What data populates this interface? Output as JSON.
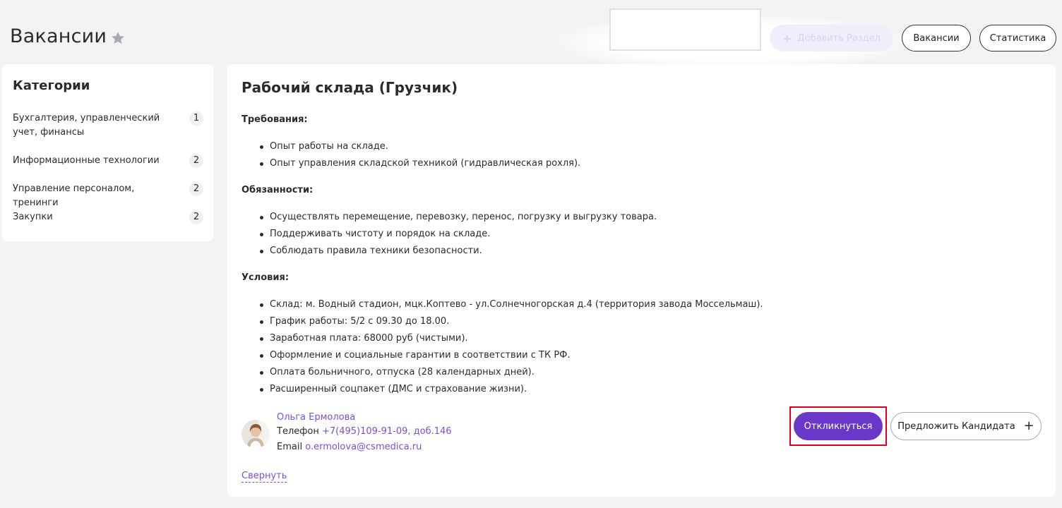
{
  "header": {
    "title": "Вакансии",
    "favorite_icon": "star-icon",
    "add_section_label": "Добавить Раздел",
    "nav": {
      "vacancies_label": "Вакансии",
      "statistics_label": "Статистика"
    }
  },
  "sidebar": {
    "title": "Категории",
    "items": [
      {
        "label": "Бухгалтерия, управленческий учет, финансы",
        "count": "1"
      },
      {
        "label": "Информационные технологии",
        "count": "2"
      },
      {
        "label": "Управление персоналом, тренинги",
        "count": "2"
      },
      {
        "label": "Закупки",
        "count": "2"
      }
    ]
  },
  "vacancy": {
    "title": "Рабочий склада (Грузчик)",
    "requirements": {
      "heading": "Требования:",
      "items": [
        "Опыт работы на складе.",
        "Опыт управления складской техникой (гидравлическая рохля)."
      ]
    },
    "duties": {
      "heading": "Обязанности:",
      "items": [
        "Осуществлять перемещение, перевозку, перенос, погрузку и выгрузку товара.",
        "Поддерживать чистоту и порядок на складе.",
        "Соблюдать правила техники безопасности."
      ]
    },
    "conditions": {
      "heading": "Условия:",
      "items": [
        "Склад: м. Водный стадион, мцк.Коптево - ул.Солнечногорская д.4 (территория завода Моссельмаш).",
        "График работы: 5/2 с 09.30 до 18.00.",
        "Заработная плата: 68000 руб (чистыми).",
        "Оформление и социальные гарантии в соответствии с ТК РФ.",
        "Оплата больничного, отпуска (28 календарных дней).",
        "Расширенный соцпакет (ДМС и страхование жизни)."
      ]
    },
    "contact": {
      "name": "Ольга Ермолова",
      "phone_label": "Телефон",
      "phone": "+7(495)109-91-09, доб.146",
      "email_label": "Email",
      "email": "o.ermolova@csmedica.ru"
    },
    "collapse_label": "Свернуть",
    "respond_label": "Откликнуться",
    "suggest_label": "Предложить Кандидата"
  },
  "colors": {
    "accent": "#6a38c8",
    "link": "#7b4fd6",
    "highlight_frame": "#e0001b",
    "background": "#f2f3f5"
  }
}
